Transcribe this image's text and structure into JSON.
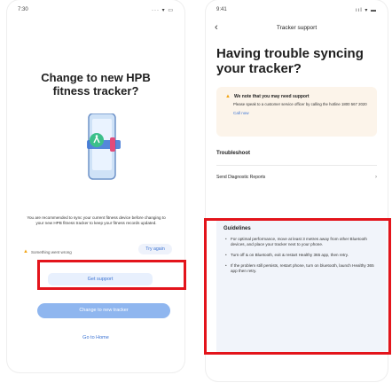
{
  "left_screen": {
    "status_time": "7:30",
    "status_icons": "··· ▾ ▭",
    "title": "Change to new HPB fitness tracker?",
    "description": "You are recommended to sync your current fitness device before changing to your new HPB fitness tracker to keep your fitness records updated.",
    "warning_text": "Something went wrong",
    "try_again_label": "Try again",
    "get_support_label": "Get support",
    "change_tracker_label": "Change to new tracker",
    "go_home_label": "Go to Home"
  },
  "right_screen": {
    "status_time": "9:41",
    "status_icons": "ııl ▾ ▬",
    "nav_title": "Tracker support",
    "back_icon": "‹",
    "title": "Having trouble syncing your tracker?",
    "alert": {
      "title": "We note that you may need support",
      "body": "Please speak to a customer service officer by calling the hotline 1800 567 2020",
      "call_now": "Call now"
    },
    "troubleshoot_heading": "Troubleshoot",
    "diagnostic_label": "Send Diagnostic Reports",
    "guidelines": {
      "title": "Guidelines",
      "items": [
        "For optimal performance, move at least 3 metres away from other Bluetooth devices, and place your tracker next to your phone.",
        "Turn off & on Bluetooth, exit & restart Healthy 365 app, then retry.",
        "If the problem still persists, restart phone, turn on bluetooth, launch Healthy 365 app then retry."
      ]
    }
  },
  "colors": {
    "accent_blue": "#3b73d3",
    "highlight_red": "#e3141b",
    "illustration_green": "#3cc08a",
    "alert_bg": "#fcf4ea",
    "warning_yellow": "#f2a516"
  }
}
